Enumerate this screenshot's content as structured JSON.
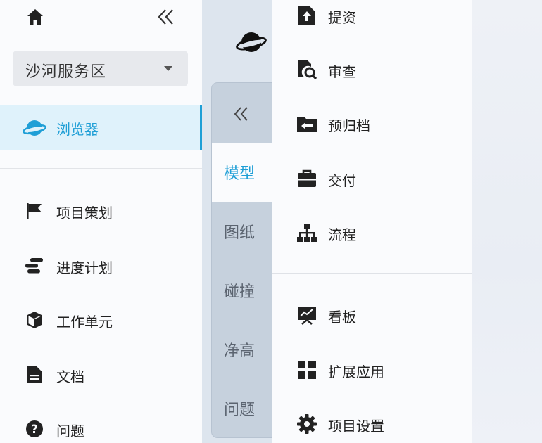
{
  "left_panel": {
    "service_area": {
      "selected": "沙河服务区"
    },
    "browser": {
      "label": "浏览器"
    },
    "nav_items": [
      {
        "label": "项目策划",
        "icon": "flag-icon"
      },
      {
        "label": "进度计划",
        "icon": "gantt-icon"
      },
      {
        "label": "工作单元",
        "icon": "cube-icon"
      },
      {
        "label": "文档",
        "icon": "document-icon"
      },
      {
        "label": "问题",
        "icon": "question-icon"
      }
    ]
  },
  "side_tabs": {
    "items": [
      {
        "label": "模型",
        "active": true
      },
      {
        "label": "图纸",
        "active": false
      },
      {
        "label": "碰撞",
        "active": false
      },
      {
        "label": "净高",
        "active": false
      },
      {
        "label": "问题",
        "active": false
      }
    ]
  },
  "menu": {
    "items": [
      {
        "label": "提资",
        "icon": "upload-file-icon"
      },
      {
        "label": "审查",
        "icon": "review-icon"
      },
      {
        "label": "预归档",
        "icon": "archive-folder-icon"
      },
      {
        "label": "交付",
        "icon": "briefcase-icon"
      },
      {
        "label": "流程",
        "icon": "flowchart-icon"
      },
      {
        "label": "看板",
        "icon": "dashboard-icon"
      },
      {
        "label": "扩展应用",
        "icon": "apps-grid-icon"
      },
      {
        "label": "项目设置",
        "icon": "gear-icon"
      }
    ]
  },
  "colors": {
    "accent": "#1f9fd6",
    "selected_bg": "#dff2fb",
    "tab_strip_bg": "#c6d1dd",
    "panel_bg": "#fafbfd"
  }
}
